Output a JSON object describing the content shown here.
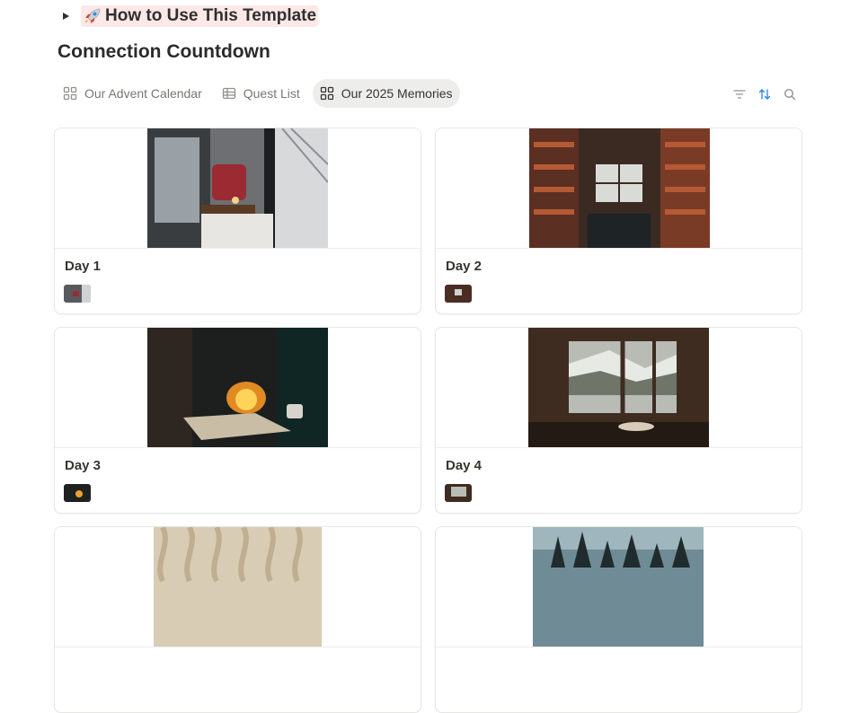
{
  "toggle": {
    "title": "How to Use This Template",
    "icon": "rocket-icon"
  },
  "database": {
    "title": "Connection Countdown"
  },
  "tabs": [
    {
      "label": "Our Advent Calendar",
      "icon": "gallery-icon",
      "active": false
    },
    {
      "label": "Quest List",
      "icon": "table-icon",
      "active": false
    },
    {
      "label": "Our 2025 Memories",
      "icon": "gallery-icon",
      "active": true
    }
  ],
  "actions": {
    "filter_icon": "filter-icon",
    "sort_icon": "sort-icon",
    "search_icon": "search-icon",
    "sort_color": "#2383e2"
  },
  "cards": [
    {
      "title": "Day 1"
    },
    {
      "title": "Day 2"
    },
    {
      "title": "Day 3"
    },
    {
      "title": "Day 4"
    },
    {
      "title": ""
    },
    {
      "title": ""
    }
  ]
}
